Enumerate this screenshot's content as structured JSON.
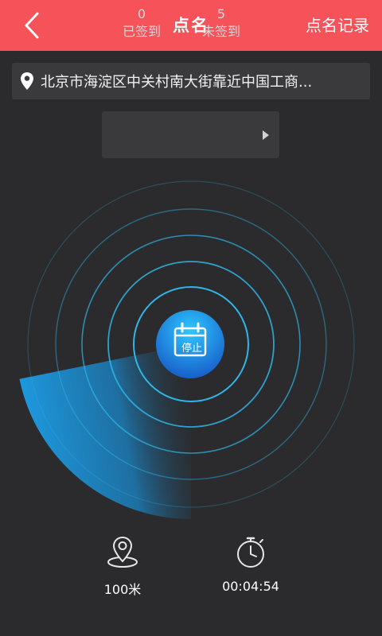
{
  "header": {
    "title": "点名",
    "back_icon": "chevron-left-icon",
    "record_label": "点名记录",
    "bg_color": "#f5525a"
  },
  "location": {
    "icon": "map-pin-icon",
    "address": "北京市海淀区中关村南大街靠近中国工商..."
  },
  "attendance": {
    "signed_count": "0",
    "signed_label": "已签到",
    "unsigned_count": "5",
    "unsigned_label": "未签到",
    "more_icon": "triangle-right-icon"
  },
  "radar": {
    "ring_color": "#2fb6e8",
    "sweep_color": "#1e9ae0",
    "stop_button": {
      "icon": "calendar-icon",
      "label": "停止"
    }
  },
  "footer": {
    "range_icon": "location-range-icon",
    "range_value": "100米",
    "timer_icon": "stopwatch-icon",
    "elapsed": "00:04:54"
  }
}
